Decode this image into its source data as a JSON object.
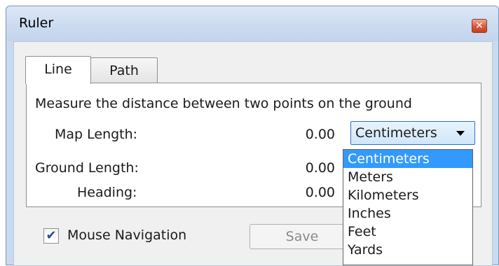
{
  "window": {
    "title": "Ruler",
    "close_glyph": "✕"
  },
  "tabs": [
    {
      "label": "Line",
      "selected": true
    },
    {
      "label": "Path",
      "selected": false
    }
  ],
  "panel": {
    "description": "Measure the distance between two points on the ground",
    "rows": [
      {
        "label": "Map Length:",
        "value": "0.00"
      },
      {
        "label": "Ground Length:",
        "value": "0.00"
      },
      {
        "label": "Heading:",
        "value": "0.00"
      }
    ]
  },
  "unit_select": {
    "selected": "Centimeters",
    "options": [
      "Centimeters",
      "Meters",
      "Kilometers",
      "Inches",
      "Feet",
      "Yards"
    ]
  },
  "footer": {
    "mouse_navigation_label": "Mouse Navigation",
    "mouse_navigation_checked": true,
    "check_glyph": "✔",
    "save_label": "Save"
  },
  "colors": {
    "selection_highlight": "#3399ff",
    "titlebar": "#c9daf0",
    "close_button": "#d9583b"
  }
}
